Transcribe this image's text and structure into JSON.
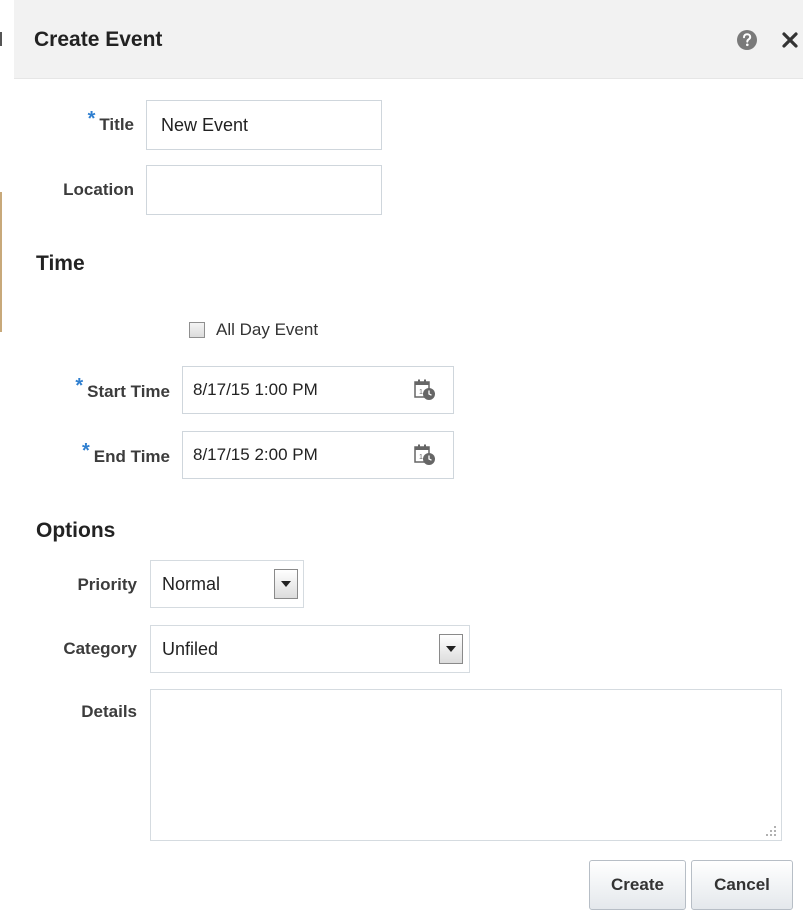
{
  "dialog": {
    "title": "Create Event",
    "help_icon": "help-circle-icon",
    "close_icon": "close-x-icon"
  },
  "general": {
    "title_label": "Title",
    "title_value": "New Event",
    "location_label": "Location",
    "location_value": ""
  },
  "time": {
    "section_label": "Time",
    "all_day_label": "All Day Event",
    "all_day_checked": false,
    "start_label": "Start Time",
    "start_value": "8/17/15 1:00 PM",
    "end_label": "End Time",
    "end_value": "8/17/15 2:00 PM",
    "picker_icon": "calendar-clock-icon"
  },
  "options": {
    "section_label": "Options",
    "priority_label": "Priority",
    "priority_value": "Normal",
    "category_label": "Category",
    "category_value": "Unfiled",
    "details_label": "Details",
    "details_value": ""
  },
  "actions": {
    "create_label": "Create",
    "cancel_label": "Cancel"
  },
  "colors": {
    "required_marker": "#2f7fd0",
    "header_bg": "#f2f2f2"
  }
}
